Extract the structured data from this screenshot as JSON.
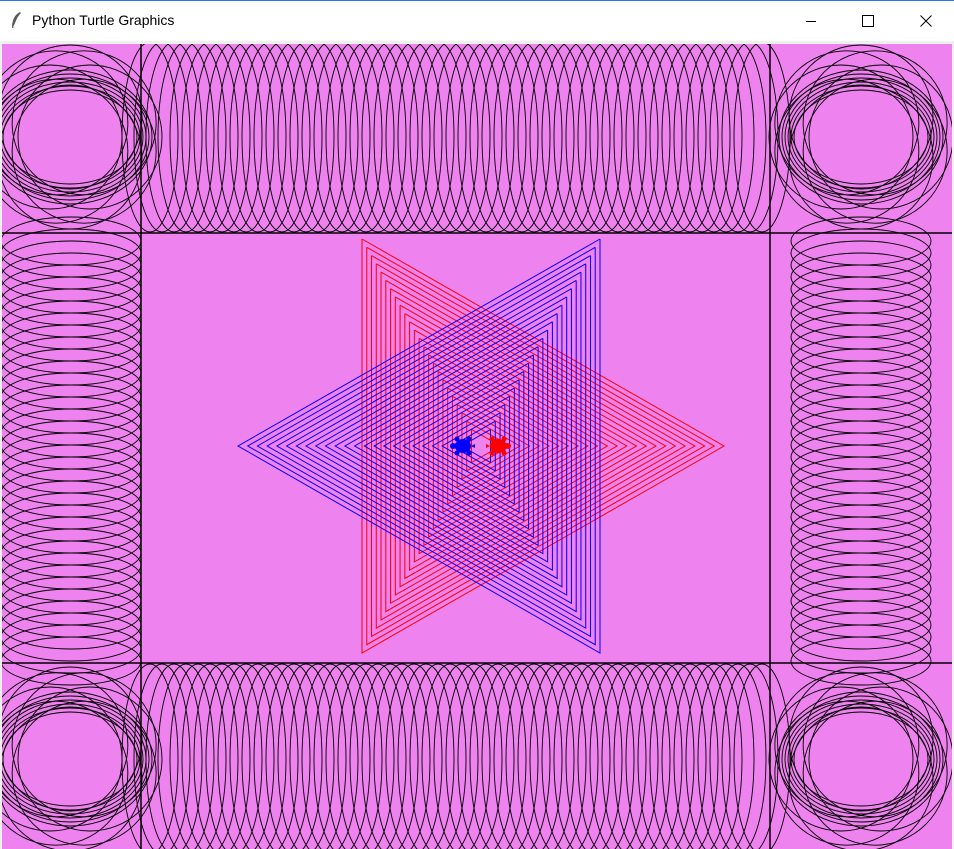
{
  "window": {
    "title": "Python Turtle Graphics",
    "icon": "feather-icon",
    "controls": [
      "minimize-icon",
      "maximize-icon",
      "close-icon"
    ]
  },
  "canvas": {
    "background": "#ee82ee",
    "pen_colors": {
      "border_pattern": "#000000",
      "star_triangles_1": "#ff0000",
      "star_triangles_2": "#0000ff"
    },
    "turtles": [
      {
        "name": "blue-turtle",
        "color": "#0000ff",
        "shape": "turtle"
      },
      {
        "name": "red-turtle",
        "color": "#ff0000",
        "shape": "turtle"
      }
    ]
  }
}
